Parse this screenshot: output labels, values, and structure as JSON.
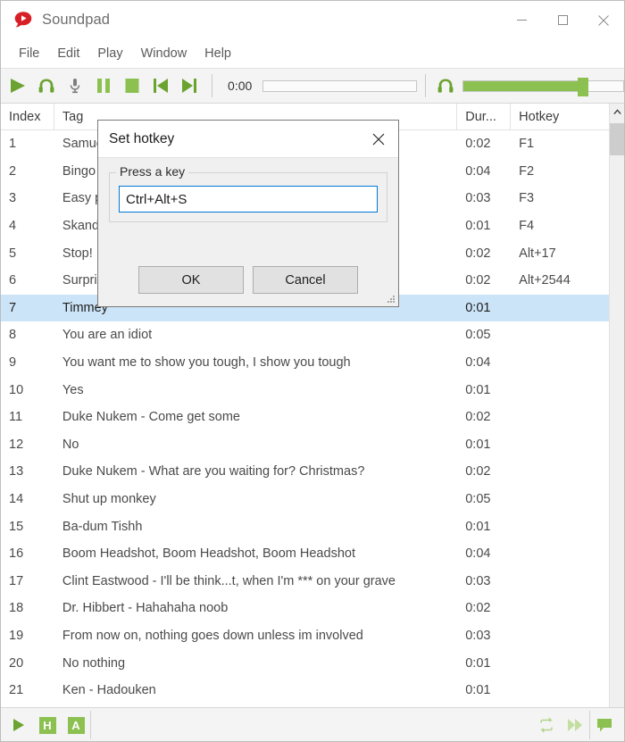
{
  "window": {
    "title": "Soundpad",
    "logo_icon": "soundpad-logo-icon",
    "controls": {
      "minimize": "minimize-icon",
      "maximize": "maximize-icon",
      "close": "close-icon"
    }
  },
  "menu": {
    "items": [
      {
        "label": "File"
      },
      {
        "label": "Edit"
      },
      {
        "label": "Play"
      },
      {
        "label": "Window"
      },
      {
        "label": "Help"
      }
    ]
  },
  "toolbar": {
    "buttons": [
      {
        "name": "play-button",
        "icon": "play-icon"
      },
      {
        "name": "headphones-button",
        "icon": "headphones-icon"
      },
      {
        "name": "microphone-button",
        "icon": "microphone-icon"
      },
      {
        "name": "pause-button",
        "icon": "pause-icon"
      },
      {
        "name": "stop-button",
        "icon": "stop-icon"
      },
      {
        "name": "previous-button",
        "icon": "previous-track-icon"
      },
      {
        "name": "next-button",
        "icon": "next-track-icon"
      }
    ],
    "time": "0:00",
    "seek_percent": 0,
    "volume_icon": "headphones-icon",
    "volume_percent": 75
  },
  "list": {
    "columns": [
      {
        "key": "index",
        "label": "Index"
      },
      {
        "key": "tag",
        "label": "Tag"
      },
      {
        "key": "duration",
        "label": "Dur..."
      },
      {
        "key": "hotkey",
        "label": "Hotkey"
      }
    ],
    "rows": [
      {
        "index": "1",
        "tag": "Samuel",
        "duration": "0:02",
        "hotkey": "F1",
        "selected": false
      },
      {
        "index": "2",
        "tag": "Bingo",
        "duration": "0:04",
        "hotkey": "F2",
        "selected": false
      },
      {
        "index": "3",
        "tag": "Easy p",
        "duration": "0:03",
        "hotkey": "F3",
        "selected": false
      },
      {
        "index": "4",
        "tag": "Skand",
        "duration": "0:01",
        "hotkey": "F4",
        "selected": false
      },
      {
        "index": "5",
        "tag": "Stop!",
        "duration": "0:02",
        "hotkey": "Alt+17",
        "selected": false
      },
      {
        "index": "6",
        "tag": "Surpri",
        "duration": "0:02",
        "hotkey": "Alt+2544",
        "selected": false
      },
      {
        "index": "7",
        "tag": "Timmey",
        "duration": "0:01",
        "hotkey": "",
        "selected": true
      },
      {
        "index": "8",
        "tag": "You are an idiot",
        "duration": "0:05",
        "hotkey": "",
        "selected": false
      },
      {
        "index": "9",
        "tag": "You want me to show you tough, I show you tough",
        "duration": "0:04",
        "hotkey": "",
        "selected": false
      },
      {
        "index": "10",
        "tag": "Yes",
        "duration": "0:01",
        "hotkey": "",
        "selected": false
      },
      {
        "index": "11",
        "tag": "Duke Nukem - Come get some",
        "duration": "0:02",
        "hotkey": "",
        "selected": false
      },
      {
        "index": "12",
        "tag": "No",
        "duration": "0:01",
        "hotkey": "",
        "selected": false
      },
      {
        "index": "13",
        "tag": "Duke Nukem - What are you waiting for? Christmas?",
        "duration": "0:02",
        "hotkey": "",
        "selected": false
      },
      {
        "index": "14",
        "tag": "Shut up monkey",
        "duration": "0:05",
        "hotkey": "",
        "selected": false
      },
      {
        "index": "15",
        "tag": "Ba-dum Tishh",
        "duration": "0:01",
        "hotkey": "",
        "selected": false
      },
      {
        "index": "16",
        "tag": "Boom Headshot, Boom Headshot, Boom Headshot",
        "duration": "0:04",
        "hotkey": "",
        "selected": false
      },
      {
        "index": "17",
        "tag": "Clint Eastwood - I'll be think...t, when I'm *** on your grave",
        "duration": "0:03",
        "hotkey": "",
        "selected": false
      },
      {
        "index": "18",
        "tag": "Dr. Hibbert - Hahahaha noob",
        "duration": "0:02",
        "hotkey": "",
        "selected": false
      },
      {
        "index": "19",
        "tag": "From now on, nothing goes down unless im involved",
        "duration": "0:03",
        "hotkey": "",
        "selected": false
      },
      {
        "index": "20",
        "tag": "No nothing",
        "duration": "0:01",
        "hotkey": "",
        "selected": false
      },
      {
        "index": "21",
        "tag": "Ken - Hadouken",
        "duration": "0:01",
        "hotkey": "",
        "selected": false
      }
    ],
    "scrollbar": {
      "up_arrow_icon": "chevron-up-icon"
    }
  },
  "statusbar": {
    "left_buttons": [
      {
        "name": "play-status-button",
        "icon": "play-icon"
      },
      {
        "name": "hotkeys-toggle-button",
        "label": "H"
      },
      {
        "name": "autoplay-toggle-button",
        "label": "A"
      }
    ],
    "right_buttons": [
      {
        "name": "loop-toggle-button",
        "icon": "loop-icon"
      },
      {
        "name": "skip-forward-button",
        "icon": "fast-forward-icon"
      },
      {
        "name": "speech-bubble-button",
        "icon": "speech-bubble-icon"
      }
    ]
  },
  "dialog": {
    "title": "Set hotkey",
    "close_icon": "close-icon",
    "group_label": "Press a key",
    "hotkey_value": "Ctrl+Alt+S",
    "hotkey_placeholder": "",
    "ok_label": "OK",
    "cancel_label": "Cancel",
    "resize_grip_icon": "resize-grip-icon"
  },
  "colors": {
    "accent_green": "#8cc152",
    "selection_blue": "#cce4f7",
    "focus_blue": "#0078d7",
    "logo_red": "#d81f26"
  }
}
